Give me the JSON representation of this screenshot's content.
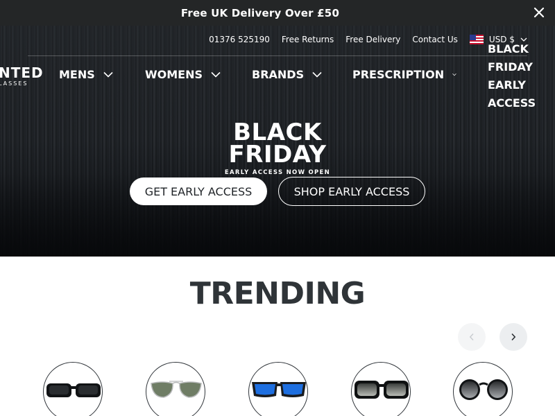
{
  "announcement": {
    "text": "Free UK Delivery Over £50",
    "close_icon": "close-icon"
  },
  "utility": {
    "phone": "01376 525190",
    "returns": "Free Returns",
    "delivery": "Free Delivery",
    "contact": "Contact Us",
    "currency": "USD $",
    "flag_icon": "us-flag-icon"
  },
  "logo": {
    "main": "NTED",
    "sub": "LASSES"
  },
  "nav": {
    "items": [
      {
        "label": "MENS"
      },
      {
        "label": "WOMENS"
      },
      {
        "label": "BRANDS"
      },
      {
        "label": "PRESCRIPTION"
      }
    ],
    "black_friday": "BLACK FRIDAY EARLY ACCESS"
  },
  "hero": {
    "title_line1": "BLACK",
    "title_line2": "FRIDAY",
    "subtitle": "EARLY ACCESS NOW OPEN",
    "primary_cta": "GET EARLY ACCESS",
    "secondary_cta": "SHOP EARLY ACCESS"
  },
  "trending": {
    "title": "TRENDING",
    "prev_icon": "chevron-left-icon",
    "next_icon": "chevron-right-icon",
    "products": [
      {
        "icon": "sunglasses-rectangular-black-icon"
      },
      {
        "icon": "sunglasses-aviator-green-icon"
      },
      {
        "icon": "sunglasses-wrap-blue-icon"
      },
      {
        "icon": "sunglasses-square-grey-icon"
      },
      {
        "icon": "sunglasses-round-grey-icon"
      }
    ]
  },
  "colors": {
    "announce_bg": "#242627",
    "heading": "#2f3438",
    "accent_blue_lens": "#1e6fe0"
  }
}
